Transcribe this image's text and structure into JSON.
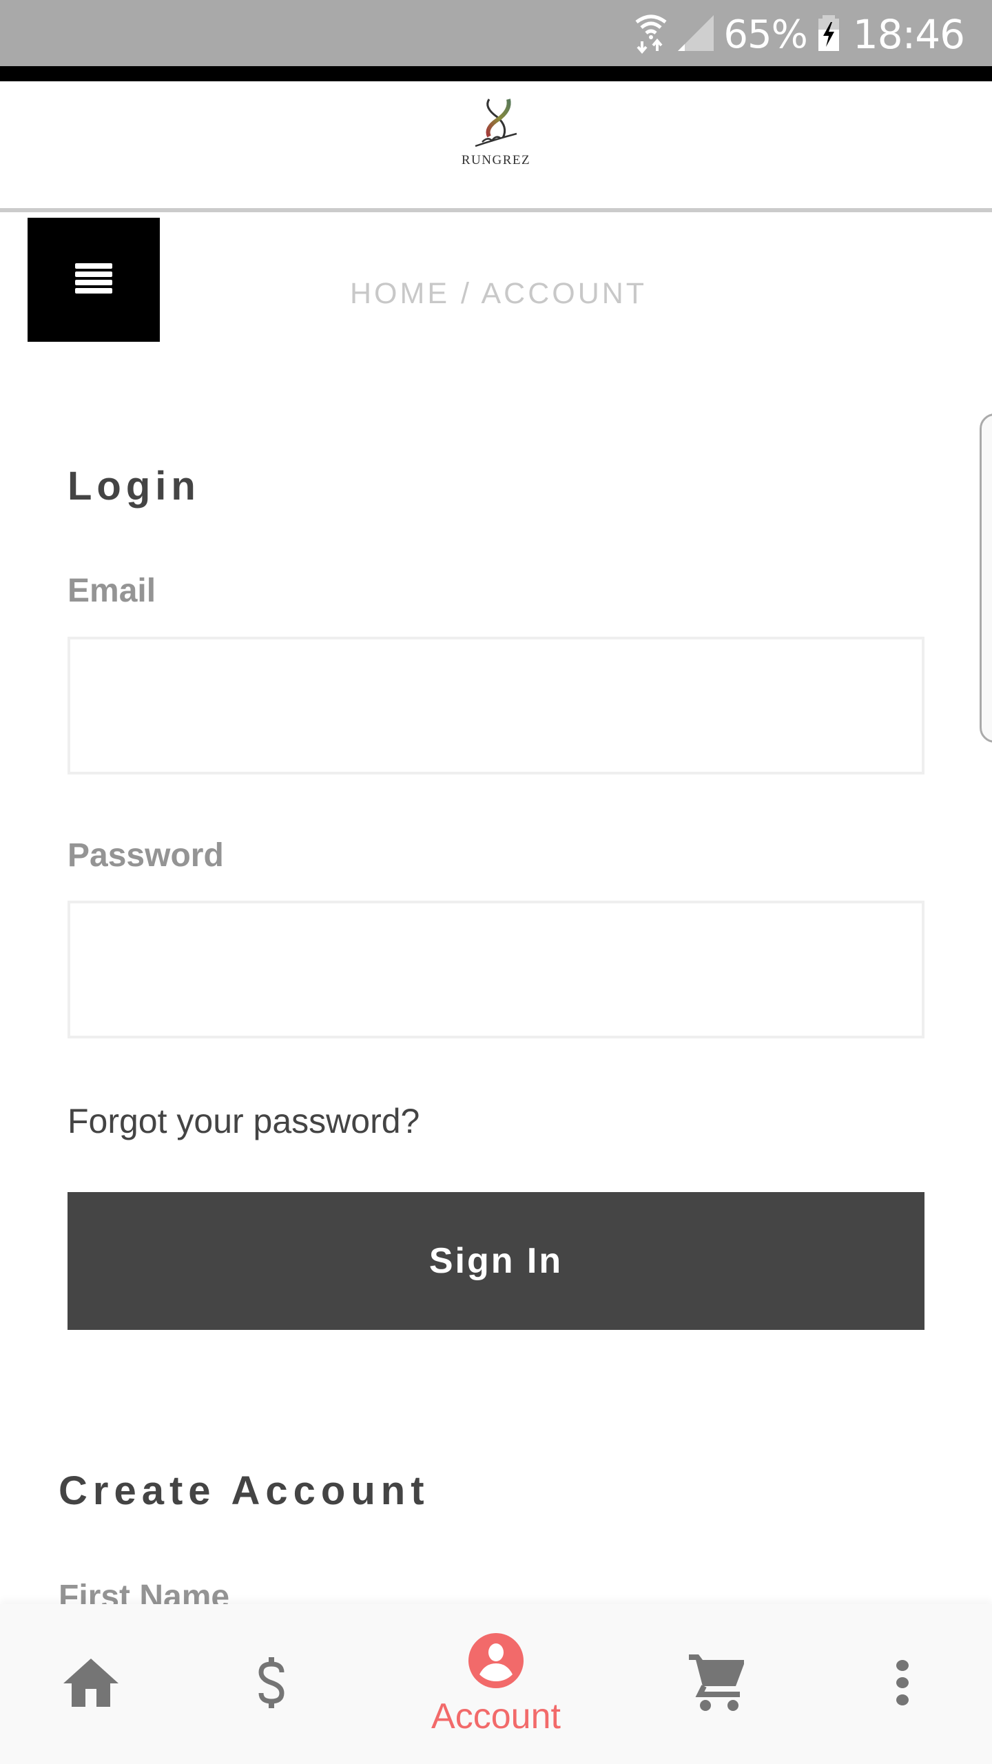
{
  "status_bar": {
    "battery_percent": "65%",
    "time": "18:46",
    "icons": [
      "wifi-data-icon",
      "cell-signal-icon",
      "battery-charging-icon"
    ]
  },
  "header": {
    "logo_text": "RUNGREZ",
    "menu_icon": "hamburger-menu-icon"
  },
  "breadcrumb": {
    "text": "HOME / ACCOUNT"
  },
  "login": {
    "title": "Login",
    "email_label": "Email",
    "email_value": "",
    "password_label": "Password",
    "password_value": "",
    "forgot_link": "Forgot your password?",
    "signin_button": "Sign In"
  },
  "create_account": {
    "title": "Create Account",
    "first_name_label": "First Name"
  },
  "bottom_nav": {
    "active_color": "#f26a6a",
    "inactive_color": "#757575",
    "items": [
      {
        "icon": "home-icon",
        "label": ""
      },
      {
        "icon": "dollar-icon",
        "label": ""
      },
      {
        "icon": "account-icon",
        "label": "Account",
        "active": true
      },
      {
        "icon": "cart-icon",
        "label": ""
      },
      {
        "icon": "more-vert-icon",
        "label": ""
      }
    ]
  }
}
